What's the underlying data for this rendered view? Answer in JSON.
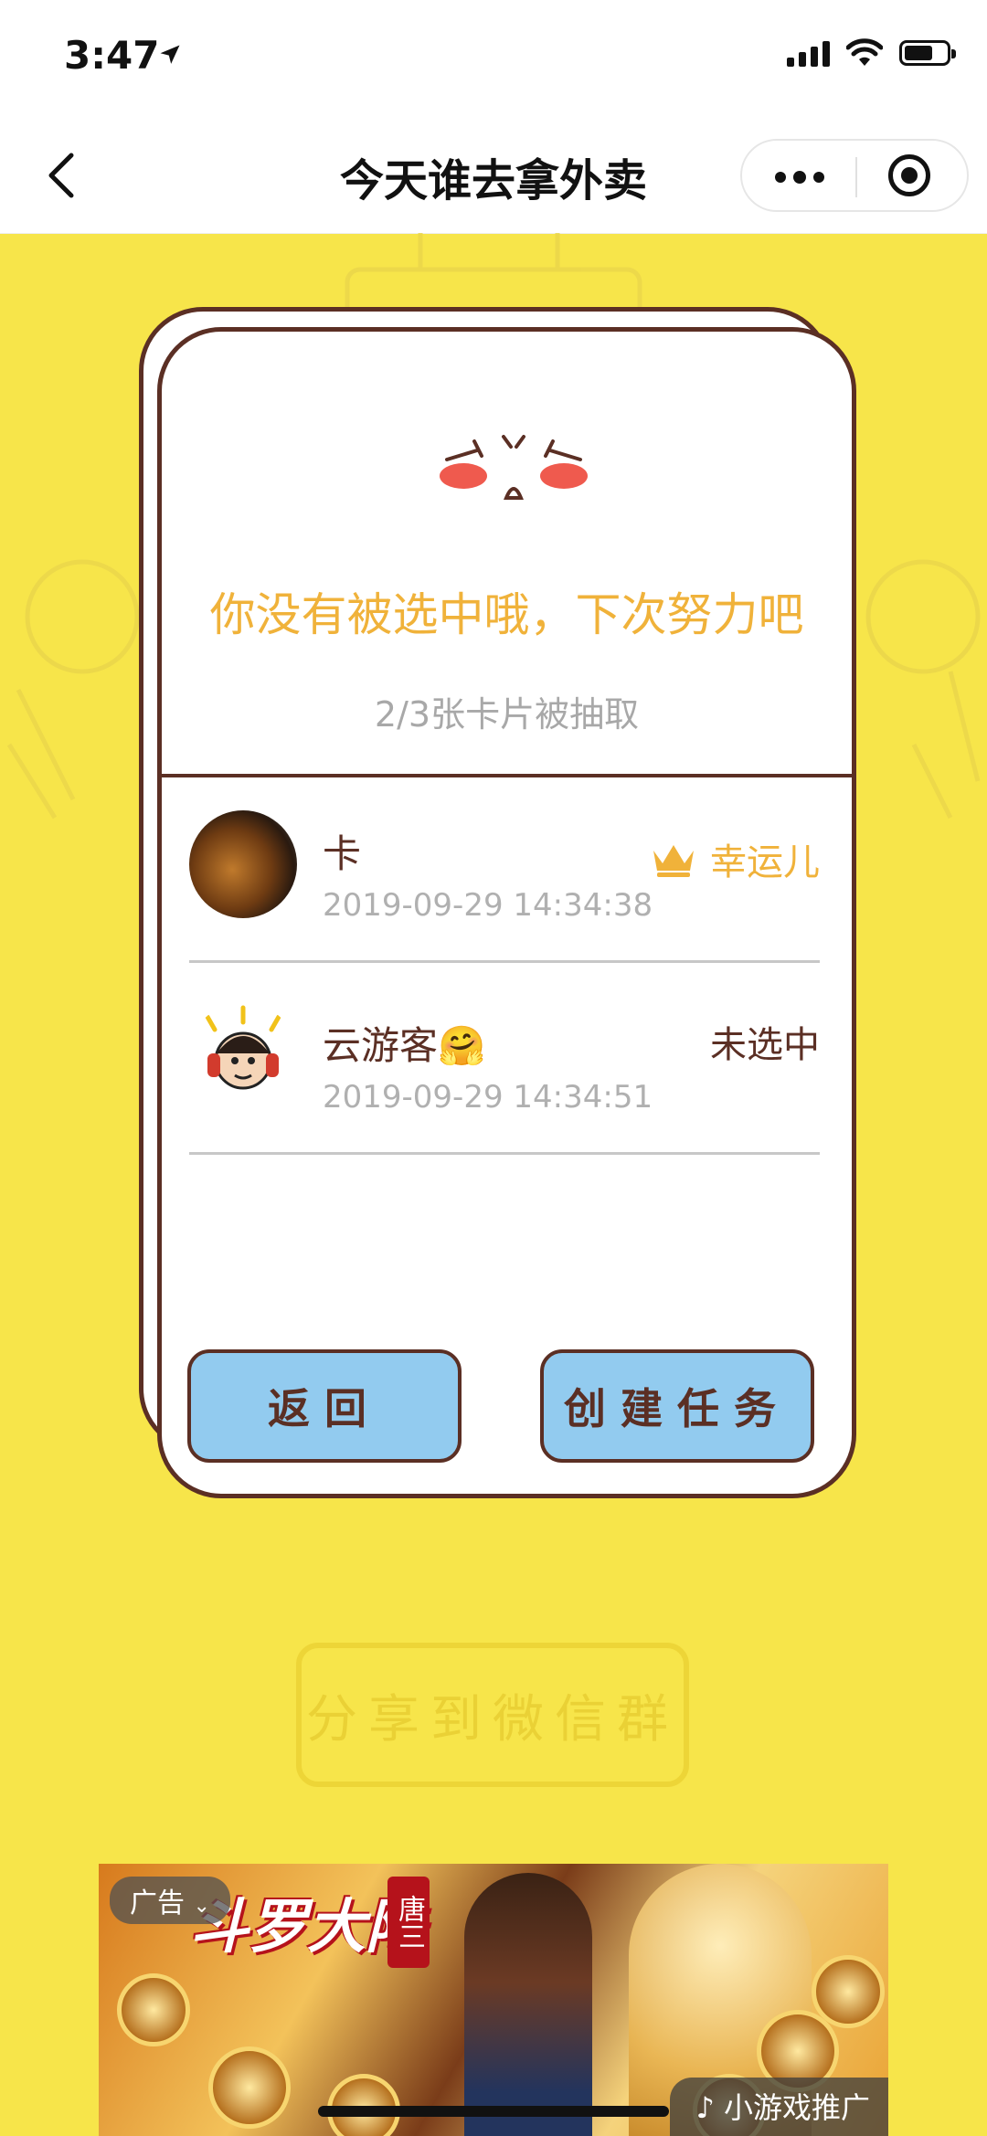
{
  "status_bar": {
    "time": "3:47",
    "battery_level": 0.6
  },
  "nav": {
    "title": "今天谁去拿外卖"
  },
  "result": {
    "message": "你没有被选中哦，下次努力吧",
    "draw_count": "2/3张卡片被抽取"
  },
  "participants": [
    {
      "name": "卡",
      "timestamp": "2019-09-29 14:34:38",
      "status": "幸运儿"
    },
    {
      "name": "云游客🤗",
      "timestamp": "2019-09-29 14:34:51",
      "status": "未选中"
    }
  ],
  "buttons": {
    "back": "返回",
    "create_task": "创建任务"
  },
  "share": {
    "label": "分享到微信群"
  },
  "ad": {
    "label": "广告",
    "title": "斗罗大陆",
    "tag": "唐三",
    "source": "小游戏推广"
  },
  "colors": {
    "background": "#F7E54A",
    "accent": "#F0B23A",
    "border": "#5b2f24",
    "button": "#92CBEF"
  }
}
